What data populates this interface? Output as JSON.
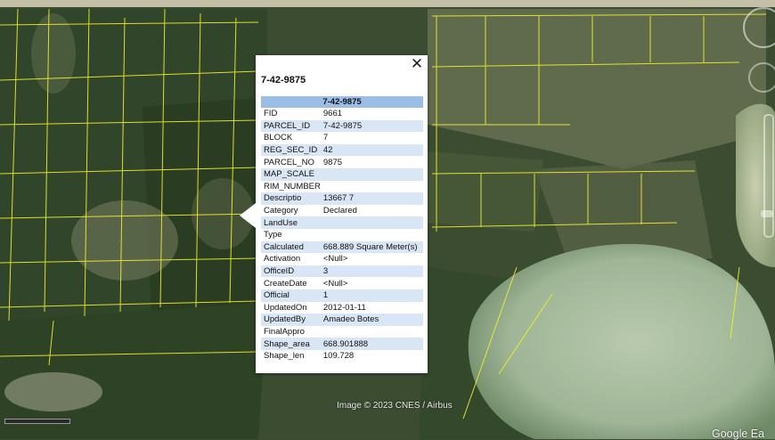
{
  "map": {
    "layer": "satellite",
    "parcel_line_color": "#f2ef2a",
    "imagery_credit": "Image © 2023 CNES / Airbus",
    "logo": "Google Ea"
  },
  "balloon": {
    "title": "7-42-9875",
    "table_header": "7-42-9875",
    "close_icon": "close-icon",
    "rows": [
      {
        "key": "FID",
        "value": "9661"
      },
      {
        "key": "PARCEL_ID",
        "value": "7-42-9875"
      },
      {
        "key": "BLOCK",
        "value": "7"
      },
      {
        "key": "REG_SEC_ID",
        "value": "42"
      },
      {
        "key": "PARCEL_NO",
        "value": "9875"
      },
      {
        "key": "MAP_SCALE",
        "value": ""
      },
      {
        "key": "RIM_NUMBER",
        "value": ""
      },
      {
        "key": "Descriptio",
        "value": "13667 7"
      },
      {
        "key": "Category",
        "value": "Declared"
      },
      {
        "key": "LandUse",
        "value": ""
      },
      {
        "key": "Type",
        "value": ""
      },
      {
        "key": "Calculated",
        "value": "668.889 Square Meter(s)"
      },
      {
        "key": "Activation",
        "value": "<Null>"
      },
      {
        "key": "OfficeID",
        "value": "3"
      },
      {
        "key": "CreateDate",
        "value": "<Null>"
      },
      {
        "key": "Official",
        "value": "1"
      },
      {
        "key": "UpdatedOn",
        "value": "2012-01-11"
      },
      {
        "key": "UpdatedBy",
        "value": "Amadeo Botes"
      },
      {
        "key": "FinalAppro",
        "value": ""
      },
      {
        "key": "Shape_area",
        "value": "668.901888"
      },
      {
        "key": "Shape_len",
        "value": "109.728"
      }
    ]
  },
  "controls": {
    "navigation": "compass-ring-icon",
    "look": "look-around-icon",
    "zoom": "zoom-slider"
  }
}
